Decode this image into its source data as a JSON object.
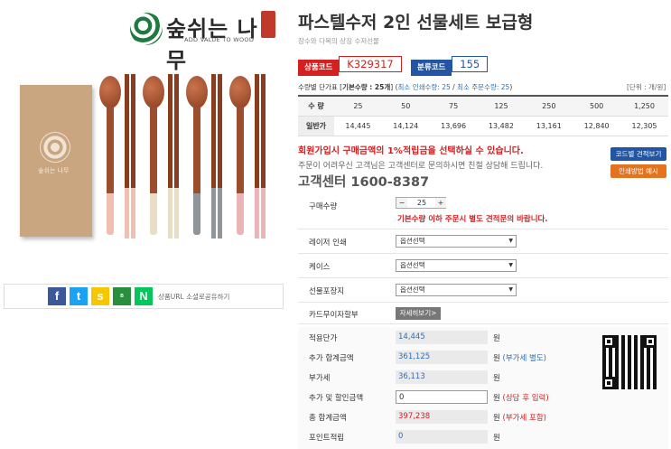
{
  "brand": {
    "name": "숲쉬는 나무",
    "tagline": "ADD VALUE TO WOOD",
    "box_text": "숲쉬는 나무"
  },
  "product": {
    "title": "파스텔수저 2인 선물세트 보급형",
    "subtitle": "장수와 다복의 상징 수저선물"
  },
  "codes": {
    "product_code_label": "상품코드",
    "product_code": "K329317",
    "class_code_label": "분류코드",
    "class_code": "155"
  },
  "price_table": {
    "caption_prefix": "수량별 단가표 [",
    "caption_base": "기본수량 : 25개",
    "caption_mid": "] (",
    "caption_min": "최소 인쇄수량: 25",
    "caption_sep": " / ",
    "caption_order": "최소 주문수량: 25",
    "caption_end": ")",
    "unit": "[단위 : 개/원]",
    "qty_header": "수 량",
    "price_header": "일반가",
    "quantities": [
      "25",
      "50",
      "75",
      "125",
      "250",
      "500",
      "1,250"
    ],
    "prices": [
      "14,445",
      "14,124",
      "13,696",
      "13,482",
      "13,161",
      "12,840",
      "12,305"
    ]
  },
  "notices": {
    "member": "회원가입시 구매금액의 1%적립금을 선택하실 수 있습니다.",
    "contact": "주문이 어려우신 고객님은 고객센터로 문의하시면 친절 상담해 드립니다.",
    "cs": "고객센터 1600-8387",
    "btn_estimate": "코드별 견적보기",
    "btn_print": "인쇄방법 예시"
  },
  "form": {
    "qty_label": "구매수량",
    "qty_value": "25",
    "qty_warning": "기본수량 이하 주문시 별도 견적문의 바랍니다.",
    "laser_label": "레이저 인쇄",
    "case_label": "케이스",
    "wrap_label": "선물포장지",
    "option_placeholder": "옵션선택",
    "card_label": "카드무이자할부",
    "detail_btn": "자세히보기>"
  },
  "calc": {
    "unit_price_label": "적용단가",
    "unit_price": "14,445",
    "unit_price_suffix": "원",
    "add_total_label": "추가 합계금액",
    "add_total": "361,125",
    "add_total_suffix": "원",
    "add_total_note": "(부가세 별도)",
    "vat_label": "부가세",
    "vat": "36,113",
    "vat_suffix": "원",
    "discount_label": "추가 및 할인금액",
    "discount": "0",
    "discount_suffix": "원",
    "discount_note": "(상담 후 입력)",
    "grand_total_label": "총 합계금액",
    "grand_total": "397,238",
    "grand_total_suffix": "원",
    "grand_total_note": "(부가세 포함)",
    "points_label": "포인트적립",
    "points": "0",
    "points_suffix": "원"
  },
  "share": {
    "label": "상품URL 소셜로공유하기",
    "icons": [
      "facebook-icon",
      "twitter-icon",
      "kakaostory-icon",
      "band-icon",
      "naver-icon"
    ]
  },
  "colors": {
    "red": "#d42020",
    "blue": "#2255a4",
    "orange": "#e3731f",
    "link": "#2d6fb7"
  }
}
